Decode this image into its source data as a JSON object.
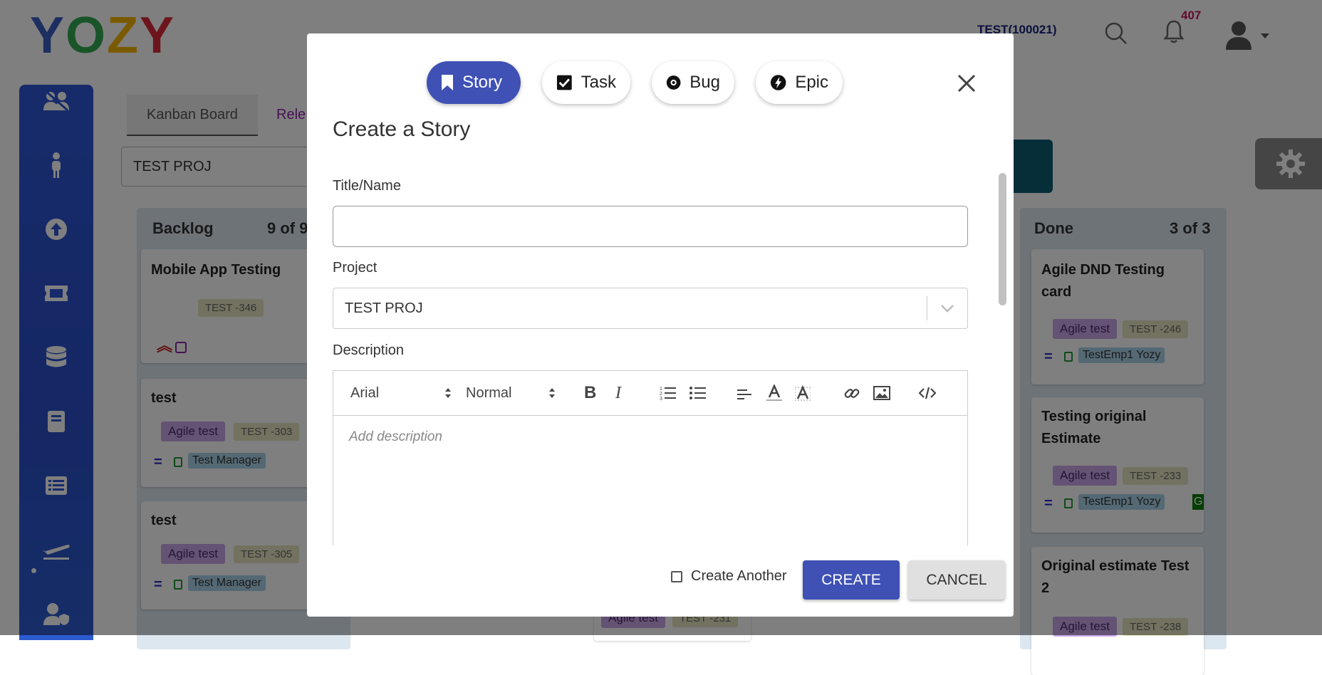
{
  "brand": {
    "logo_letters": [
      "Y",
      "O",
      "Z",
      "Y"
    ],
    "logo_colors": [
      "#3b5fc0",
      "#34a853",
      "#f4b400",
      "#db2b39"
    ]
  },
  "header": {
    "tenant": "TEST(100021)",
    "notification_count": "407"
  },
  "board": {
    "tabs": [
      "Kanban Board",
      "Rele"
    ],
    "project_value": "TEST PROJ",
    "backlog": {
      "title": "Backlog",
      "count": "9 of 9",
      "cards": [
        {
          "title": "Mobile App Testing",
          "id": "TEST -346"
        },
        {
          "title": "test",
          "epic": "Agile test",
          "id": "TEST -303",
          "assignee": "Test Manager"
        },
        {
          "title": "test",
          "epic": "Agile test",
          "id": "TEST -305",
          "assignee": "Test Manager"
        }
      ]
    },
    "mid_card": {
      "epic": "Agile test",
      "id": "TEST -231"
    },
    "done": {
      "title": "Done",
      "count": "3 of 3",
      "cards": [
        {
          "title": "Agile DND Testing card",
          "epic": "Agile test",
          "id": "TEST -246",
          "assignee": "TestEmp1 Yozy"
        },
        {
          "title": "Testing original Estimate",
          "epic": "Agile test",
          "id": "TEST -233",
          "assignee": "TestEmp1 Yozy",
          "extra": "G"
        },
        {
          "title": "Original estimate Test 2",
          "epic": "Agile test",
          "id": "TEST -238"
        }
      ]
    }
  },
  "modal": {
    "types": [
      "Story",
      "Task",
      "Bug",
      "Epic"
    ],
    "active_type": "Story",
    "title": "Create a Story",
    "title_label": "Title/Name",
    "title_value": "",
    "project_label": "Project",
    "project_value": "TEST PROJ",
    "description_label": "Description",
    "font_select": "Arial",
    "size_select": "Normal",
    "description_placeholder": "Add description",
    "create_another_label": "Create Another",
    "create_label": "CREATE",
    "cancel_label": "CANCEL"
  },
  "colors": {
    "primary": "#3f51b5",
    "sidebar": "#2f55d4",
    "epic_chip": "#c9a6e8",
    "id_chip": "#e7e5c0",
    "assignee_chip": "#a9d3e8"
  }
}
